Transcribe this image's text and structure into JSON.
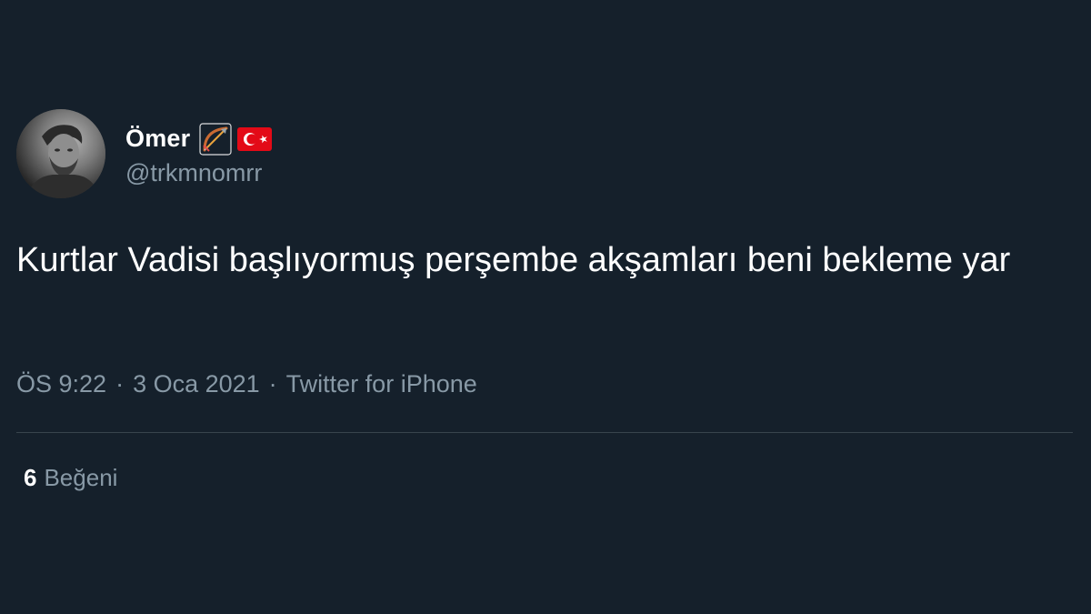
{
  "tweet": {
    "author": {
      "display_name": "Ömer",
      "handle": "@trkmnomrr",
      "emoji_icons": [
        "bow-and-arrow-icon",
        "turkey-flag-icon"
      ]
    },
    "text": "Kurtlar Vadisi başlıyormuş perşembe akşamları beni bekleme yar",
    "time": "ÖS 9:22",
    "date": "3 Oca 2021",
    "source": "Twitter for iPhone",
    "separator": "·",
    "likes": {
      "count": "6",
      "label": "Beğeni"
    }
  },
  "colors": {
    "background": "#15202b",
    "primary_text": "#ffffff",
    "secondary_text": "#8899a6",
    "divider": "#38444d",
    "flag_red": "#e30a17"
  }
}
